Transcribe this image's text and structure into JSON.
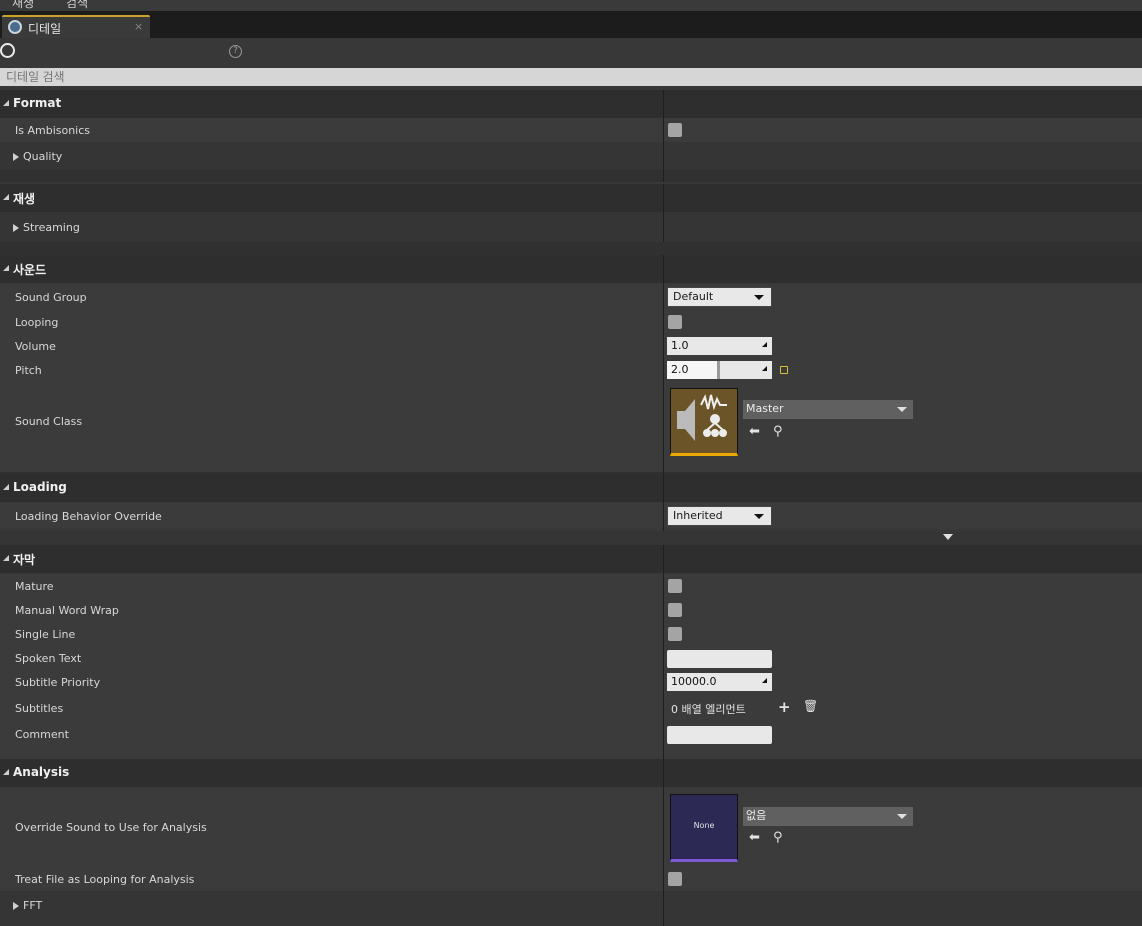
{
  "menu": {
    "items": [
      "재생",
      "검색"
    ]
  },
  "tab": {
    "title": "디테일",
    "close": "×"
  },
  "toolbar": {
    "help": "?"
  },
  "search": {
    "placeholder": "디테일 검색"
  },
  "categories": {
    "format": {
      "title": "Format",
      "is_ambisonics": "Is Ambisonics",
      "quality": "Quality"
    },
    "playback": {
      "title": "재생",
      "streaming": "Streaming"
    },
    "sound": {
      "title": "사운드",
      "sound_group": "Sound Group",
      "sound_group_value": "Default",
      "looping": "Looping",
      "volume": "Volume",
      "volume_value": "1.0",
      "pitch": "Pitch",
      "pitch_value": "2.0",
      "sound_class": "Sound Class",
      "sound_class_value": "Master"
    },
    "loading": {
      "title": "Loading",
      "override": "Loading Behavior Override",
      "override_value": "Inherited"
    },
    "subtitles": {
      "title": "자막",
      "mature": "Mature",
      "manual_word_wrap": "Manual Word Wrap",
      "single_line": "Single Line",
      "spoken_text": "Spoken Text",
      "subtitle_priority": "Subtitle Priority",
      "subtitle_priority_value": "10000.0",
      "subtitles": "Subtitles",
      "subtitles_value": "0 배열 엘리먼트",
      "comment": "Comment"
    },
    "analysis": {
      "title": "Analysis",
      "override_sound": "Override Sound to Use for Analysis",
      "override_sound_value": "없음",
      "thumb_none": "None",
      "treat_looping": "Treat File as Looping for Analysis",
      "fft": "FFT"
    }
  },
  "pitch_slider_fraction": 0.5
}
